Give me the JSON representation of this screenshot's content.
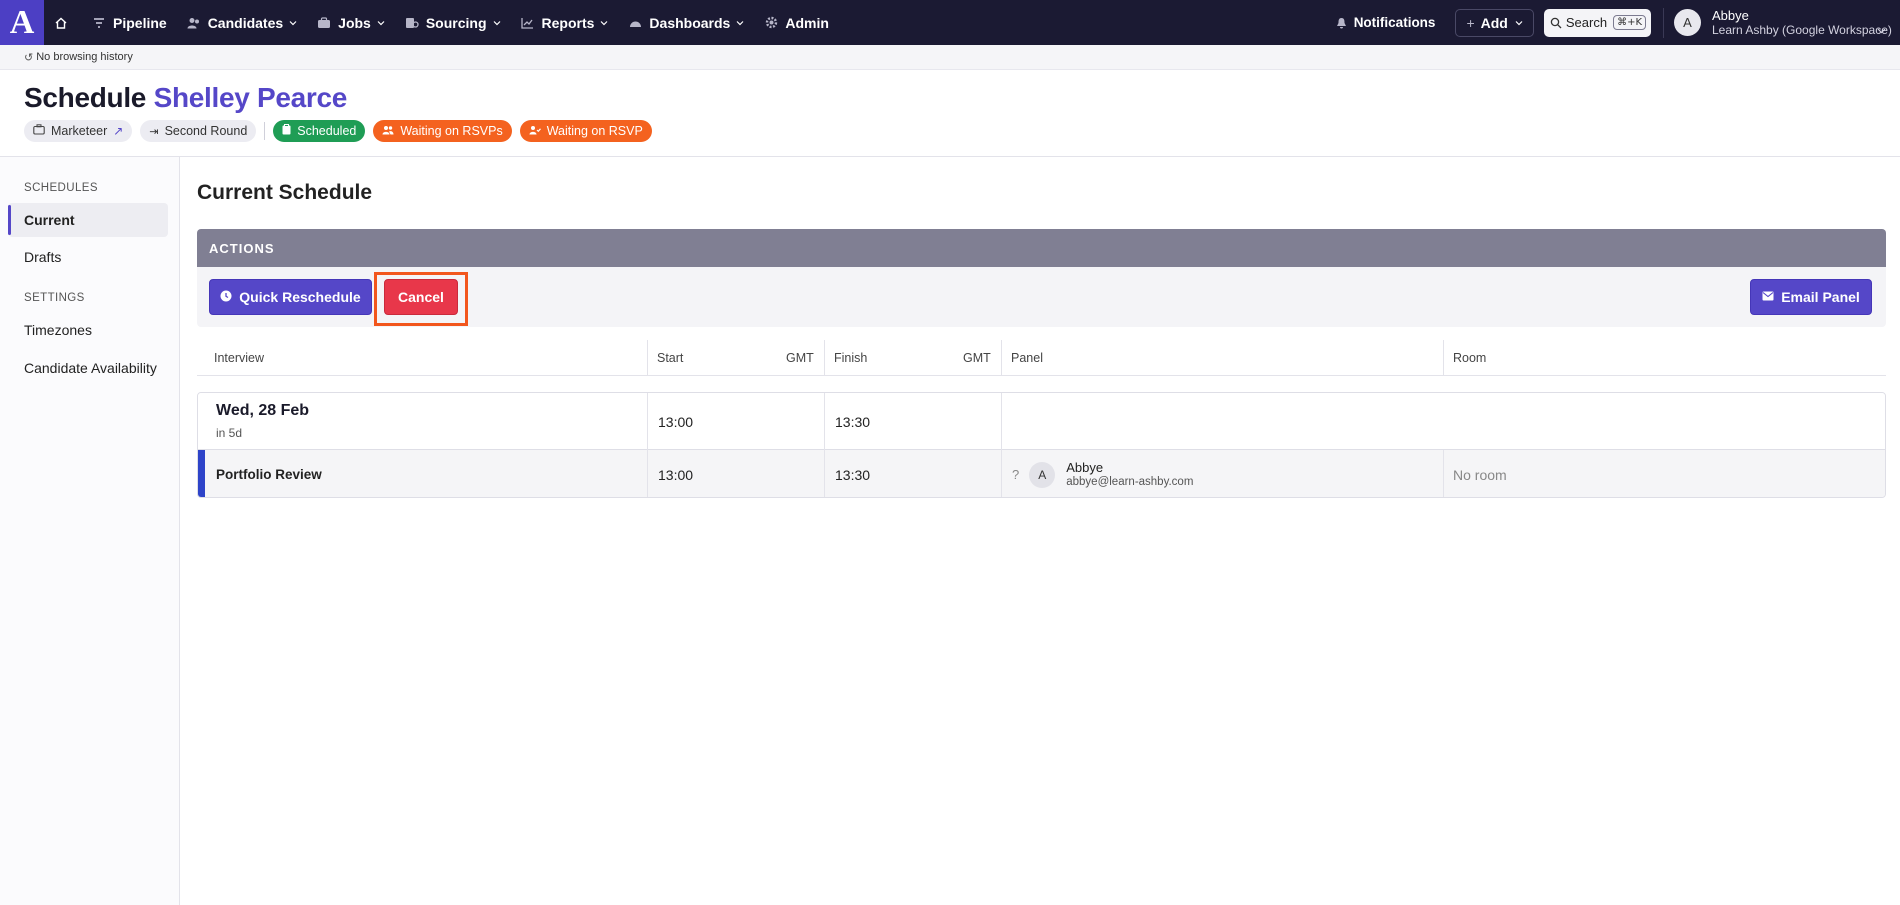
{
  "nav": {
    "logo": "A",
    "items": [
      {
        "label": "Pipeline",
        "icon": "filter-icon",
        "chevron": false
      },
      {
        "label": "Candidates",
        "icon": "people-icon",
        "chevron": true
      },
      {
        "label": "Jobs",
        "icon": "briefcase-icon",
        "chevron": true
      },
      {
        "label": "Sourcing",
        "icon": "sourcing-icon",
        "chevron": true
      },
      {
        "label": "Reports",
        "icon": "chart-icon",
        "chevron": true
      },
      {
        "label": "Dashboards",
        "icon": "gauge-icon",
        "chevron": true
      },
      {
        "label": "Admin",
        "icon": "gear-icon",
        "chevron": false
      }
    ],
    "notifications": "Notifications",
    "add": "Add",
    "search": "Search",
    "search_shortcut": "⌘+K",
    "user_initial": "A",
    "user_name": "Abbye",
    "user_org": "Learn Ashby (Google Workspace)"
  },
  "history": {
    "text": "No browsing history"
  },
  "header": {
    "title_prefix": "Schedule",
    "candidate": "Shelley Pearce",
    "chips": {
      "job": "Marketeer",
      "stage": "Second Round",
      "status": "Scheduled",
      "rsvps": "Waiting on RSVPs",
      "rsvp": "Waiting on RSVP"
    }
  },
  "sidebar": {
    "schedules_heading": "SCHEDULES",
    "current": "Current",
    "drafts": "Drafts",
    "settings_heading": "SETTINGS",
    "timezones": "Timezones",
    "availability": "Candidate Availability"
  },
  "main": {
    "title": "Current Schedule",
    "actions_heading": "ACTIONS",
    "quick_reschedule": "Quick Reschedule",
    "cancel": "Cancel",
    "email_panel": "Email Panel",
    "columns": {
      "interview": "Interview",
      "start": "Start",
      "start_tz": "GMT",
      "finish": "Finish",
      "finish_tz": "GMT",
      "panel": "Panel",
      "room": "Room"
    },
    "day": {
      "date": "Wed, 28 Feb",
      "relative": "in 5d",
      "start": "13:00",
      "finish": "13:30"
    },
    "interview": {
      "name": "Portfolio Review",
      "start": "13:00",
      "finish": "13:30",
      "panel_status": "?",
      "panel_initial": "A",
      "panel_name": "Abbye",
      "panel_email": "abbye@learn-ashby.com",
      "room": "No room"
    }
  },
  "colors": {
    "nav_bg": "#1b1a33",
    "brand": "#5547c8",
    "cancel": "#e8374a",
    "scheduled": "#1f9d55",
    "waiting": "#f4621f",
    "highlight": "#f2561d",
    "interview_accent": "#2e44c9"
  }
}
